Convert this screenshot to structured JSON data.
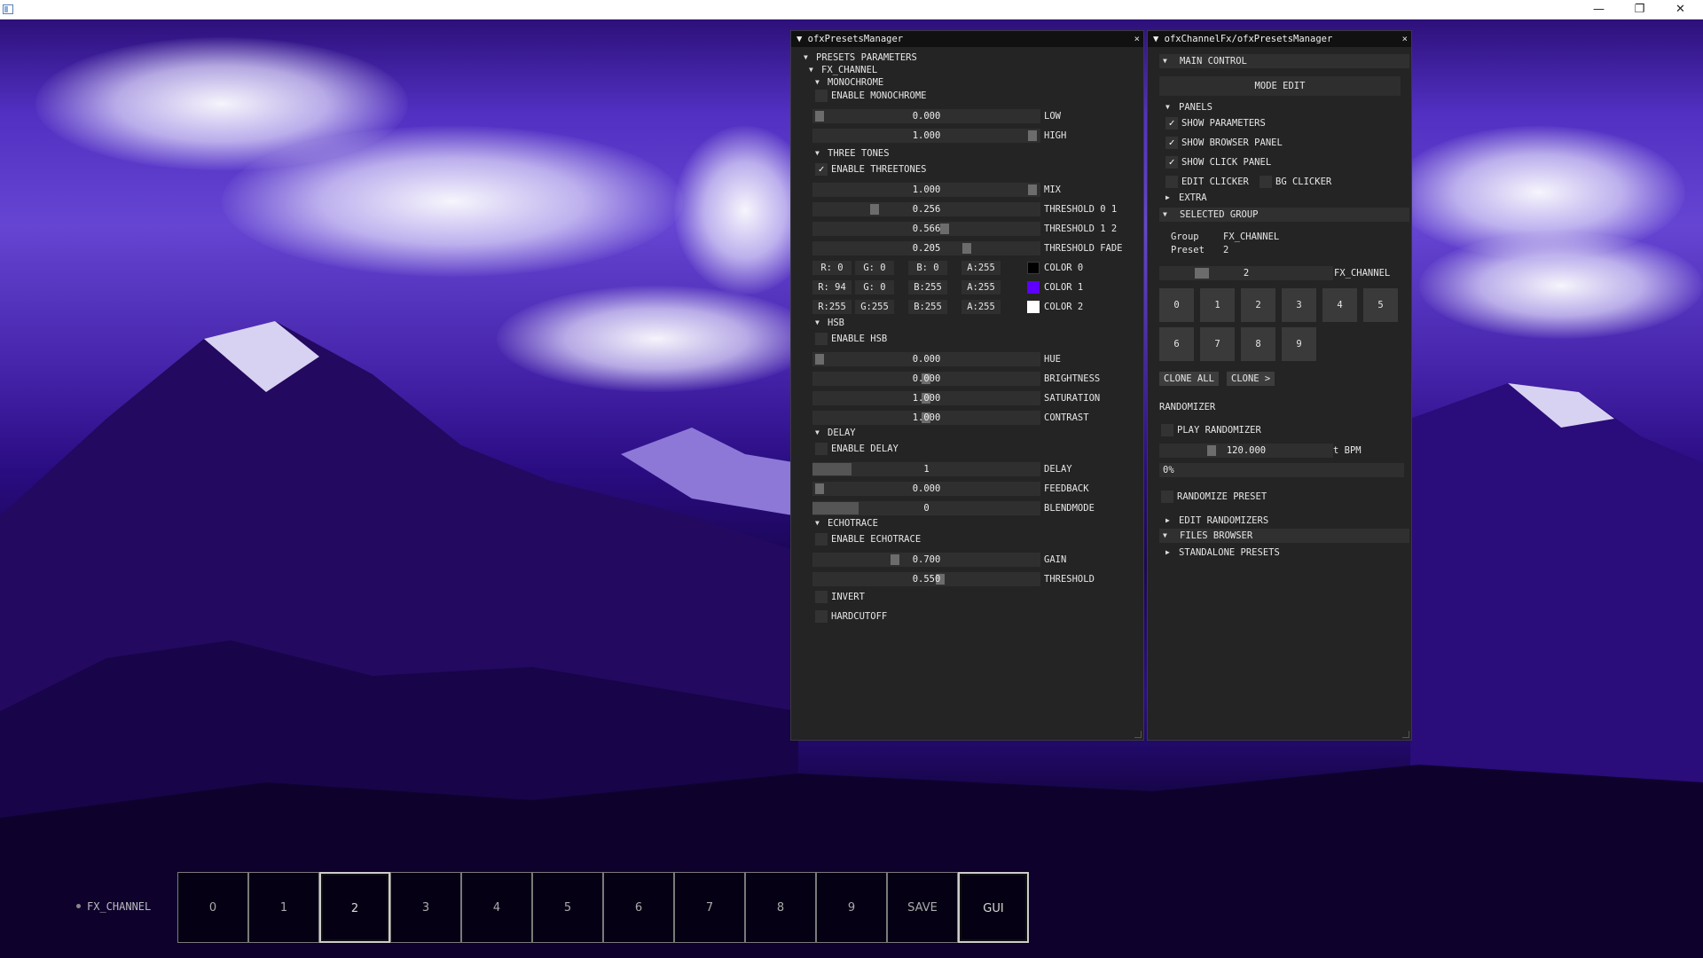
{
  "titlebar": {
    "minimize": "—",
    "restore": "❐",
    "close": "✕"
  },
  "p1": {
    "title": "▼ ofxPresetsManager",
    "close": "×",
    "presets_parameters": "PRESETS PARAMETERS",
    "fx_channel": "FX_CHANNEL",
    "mono": {
      "header": "MONOCHROME",
      "enable": "ENABLE MONOCHROME",
      "low": {
        "value": "0.000",
        "label": "LOW"
      },
      "high": {
        "value": "1.000",
        "label": "HIGH"
      }
    },
    "three": {
      "header": "THREE TONES",
      "enable": "ENABLE THREETONES",
      "mix": {
        "value": "1.000",
        "label": "MIX"
      },
      "t01": {
        "value": "0.256",
        "label": "THRESHOLD 0 1"
      },
      "t12": {
        "value": "0.566",
        "label": "THRESHOLD 1 2"
      },
      "tfade": {
        "value": "0.205",
        "label": "THRESHOLD FADE"
      },
      "colors": [
        {
          "r": "R:  0",
          "g": "G:  0",
          "b": "B:  0",
          "a": "A:255",
          "label": "COLOR 0",
          "hex": "#000000"
        },
        {
          "r": "R: 94",
          "g": "G:  0",
          "b": "B:255",
          "a": "A:255",
          "label": "COLOR 1",
          "hex": "#5e00ff"
        },
        {
          "r": "R:255",
          "g": "G:255",
          "b": "B:255",
          "a": "A:255",
          "label": "COLOR 2",
          "hex": "#ffffff"
        }
      ]
    },
    "hsb": {
      "header": "HSB",
      "enable": "ENABLE HSB",
      "hue": {
        "value": "0.000",
        "label": "HUE"
      },
      "brightness": {
        "value": "0.000",
        "label": "BRIGHTNESS"
      },
      "saturation": {
        "value": "1.000",
        "label": "SATURATION"
      },
      "contrast": {
        "value": "1.000",
        "label": "CONTRAST"
      }
    },
    "delay": {
      "header": "DELAY",
      "enable": "ENABLE DELAY",
      "delay": {
        "value": "1",
        "label": "DELAY"
      },
      "feedback": {
        "value": "0.000",
        "label": "FEEDBACK"
      },
      "blend": {
        "value": "0",
        "label": "BLENDMODE"
      }
    },
    "echo": {
      "header": "ECHOTRACE",
      "enable": "ENABLE ECHOTRACE",
      "gain": {
        "value": "0.700",
        "label": "GAIN"
      },
      "threshold": {
        "value": "0.550",
        "label": "THRESHOLD"
      }
    },
    "invert": "INVERT",
    "hardcutoff": "HARDCUTOFF"
  },
  "p2": {
    "title": "▼ ofxChannelFx/ofxPresetsManager",
    "close": "×",
    "main_control": "MAIN CONTROL",
    "mode_edit": "MODE EDIT",
    "panels": "PANELS",
    "show_params": "SHOW PARAMETERS",
    "show_browser": "SHOW BROWSER PANEL",
    "show_click": "SHOW CLICK PANEL",
    "edit_clicker": "EDIT CLICKER",
    "bg_clicker": "BG CLICKER",
    "extra": "EXTRA",
    "selected_group": "SELECTED GROUP",
    "group_key": "Group",
    "group_val": "FX_CHANNEL",
    "preset_key": "Preset",
    "preset_val": "2",
    "slider_value": "2",
    "slider_label": "FX_CHANNEL",
    "presets": [
      "0",
      "1",
      "2",
      "3",
      "4",
      "5",
      "6",
      "7",
      "8",
      "9"
    ],
    "clone_all": "CLONE ALL",
    "clone": "CLONE >",
    "randomizer": "RANDOMIZER",
    "play_randomizer": "PLAY RANDOMIZER",
    "bpm_value": "120.000",
    "bpm_label": "t BPM",
    "progress": "0%",
    "randomize_preset": "RANDOMIZE PRESET",
    "edit_randomizers": "EDIT RANDOMIZERS",
    "files_browser": "FILES BROWSER",
    "standalone": "STANDALONE PRESETS"
  },
  "bottom": {
    "label": "FX_CHANNEL",
    "buttons": [
      "0",
      "1",
      "2",
      "3",
      "4",
      "5",
      "6",
      "7",
      "8",
      "9",
      "SAVE",
      "GUI"
    ]
  }
}
